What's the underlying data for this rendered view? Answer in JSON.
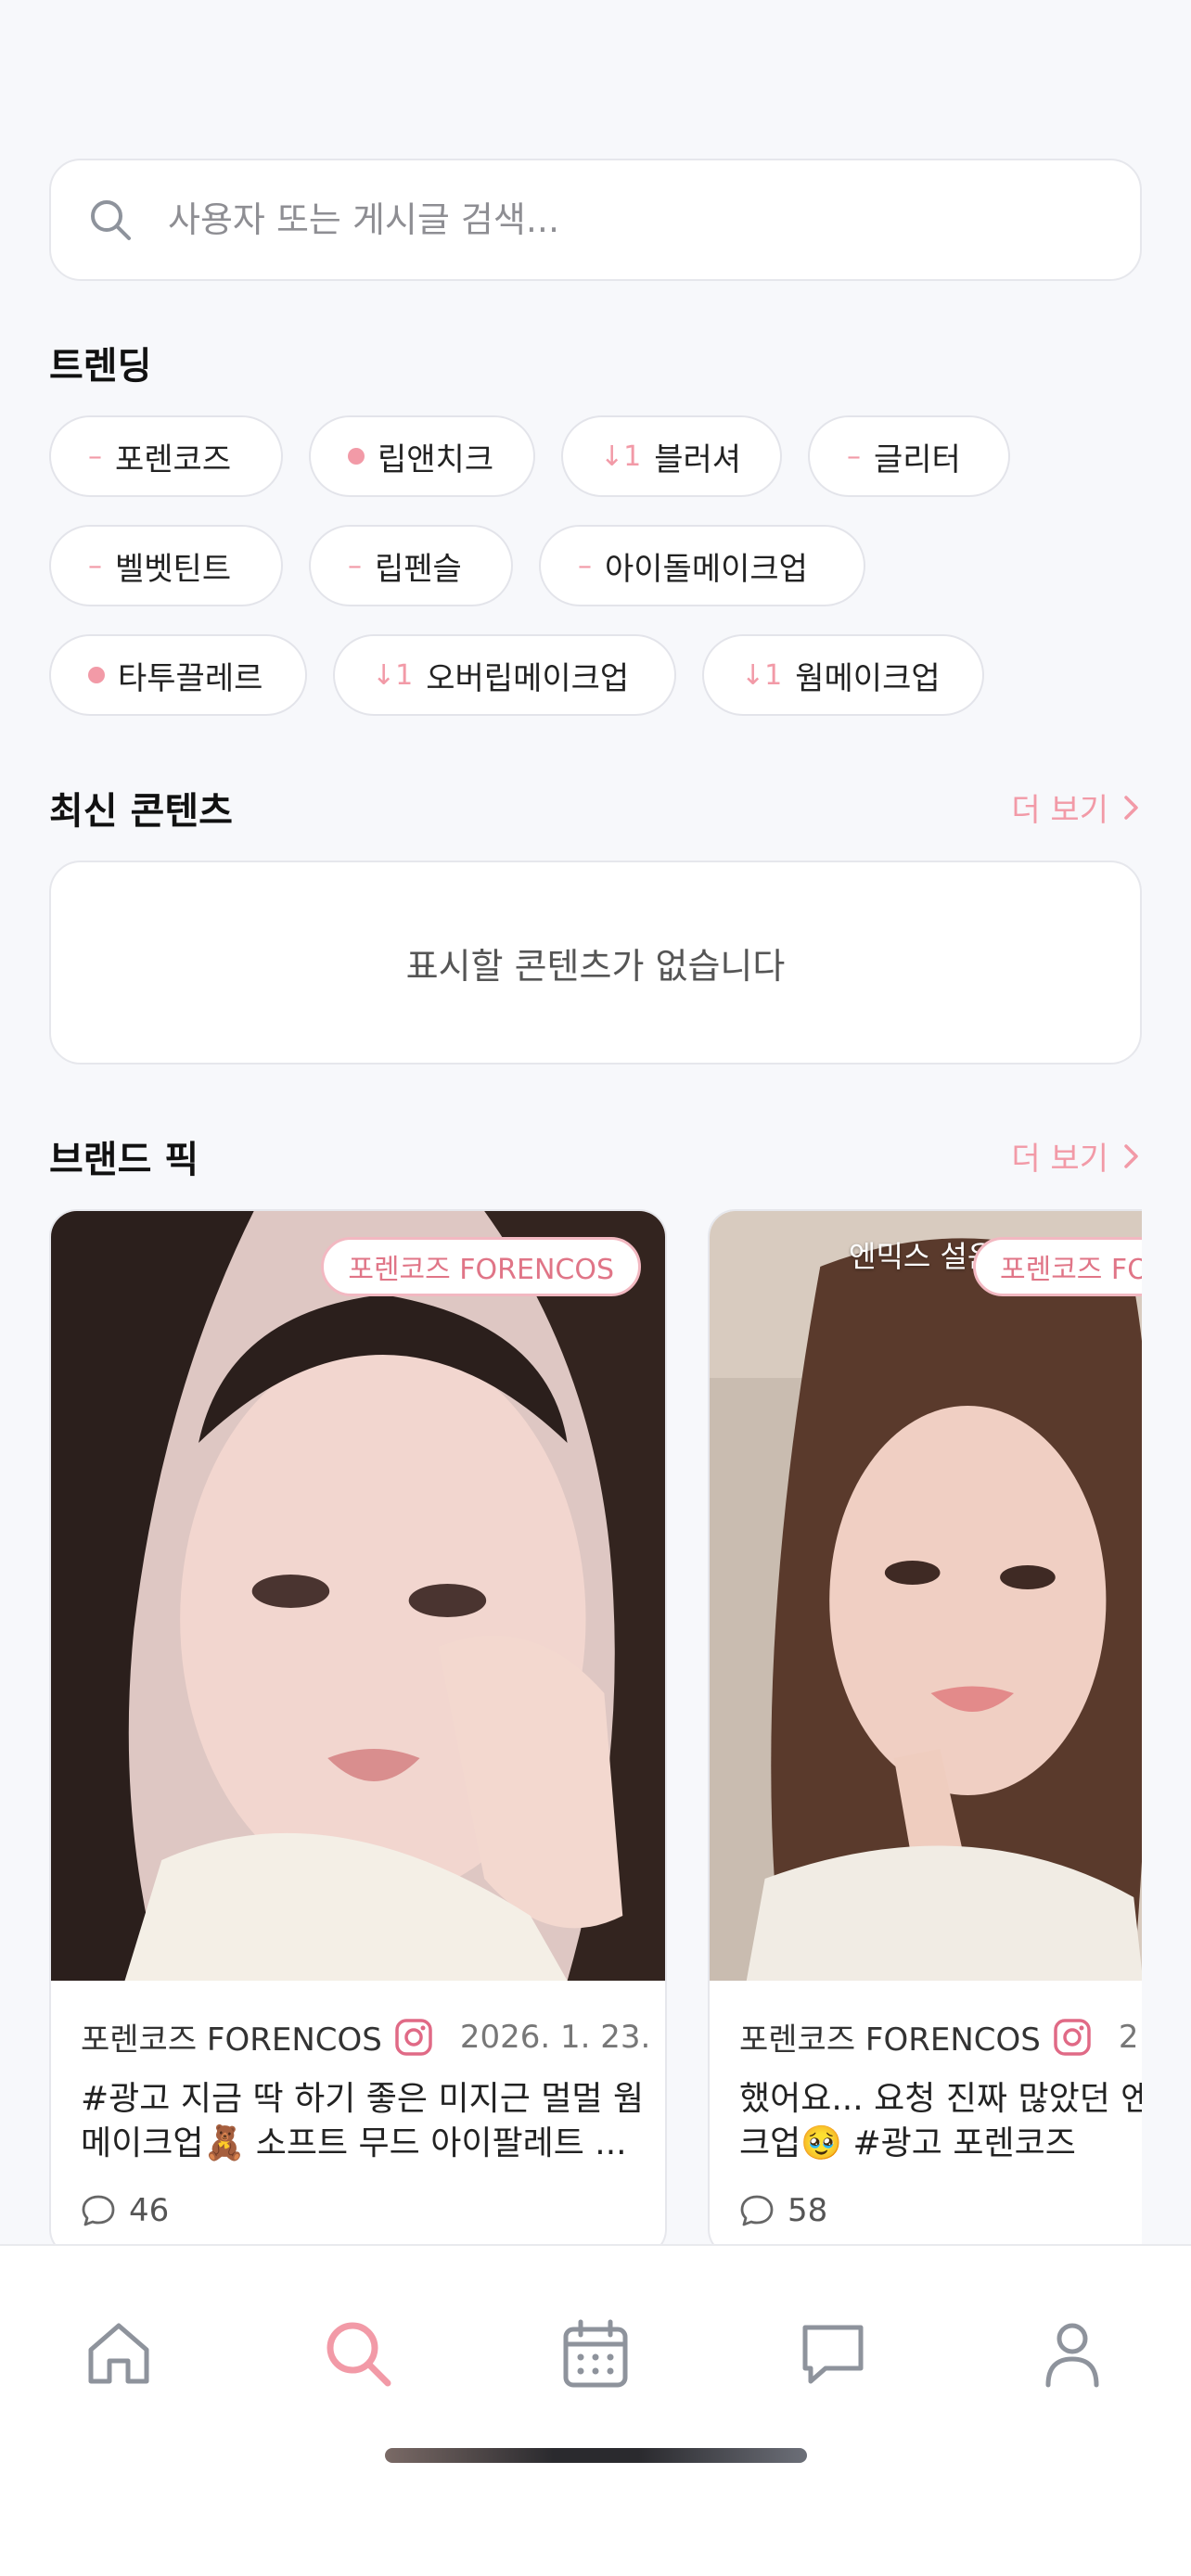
{
  "search": {
    "placeholder": "사용자 또는 게시글 검색..."
  },
  "trending": {
    "title": "트렌딩",
    "rows": [
      [
        {
          "trend": "–",
          "trend_type": "flat",
          "label": "포렌코즈"
        },
        {
          "trend": "",
          "trend_type": "new",
          "label": "립앤치크"
        },
        {
          "trend": "↓1",
          "trend_type": "down",
          "label": "블러셔"
        },
        {
          "trend": "–",
          "trend_type": "flat",
          "label": "글리터"
        }
      ],
      [
        {
          "trend": "–",
          "trend_type": "flat",
          "label": "벨벳틴트"
        },
        {
          "trend": "–",
          "trend_type": "flat",
          "label": "립펜슬"
        },
        {
          "trend": "–",
          "trend_type": "flat",
          "label": "아이돌메이크업"
        }
      ],
      [
        {
          "trend": "",
          "trend_type": "new",
          "label": "타투끌레르"
        },
        {
          "trend": "↓1",
          "trend_type": "down",
          "label": "오버립메이크업"
        },
        {
          "trend": "↓1",
          "trend_type": "down",
          "label": "웜메이크업"
        }
      ]
    ]
  },
  "latest": {
    "title": "최신 콘텐츠",
    "more_label": "더 보기",
    "empty_text": "표시할 콘텐츠가 없습니다"
  },
  "brand_pick": {
    "title": "브랜드 픽",
    "more_label": "더 보기",
    "cards": [
      {
        "badge": "포렌코즈 FORENCOS",
        "overlay": "",
        "author": "포렌코즈 FORENCOS",
        "date": "2026. 1. 23.",
        "caption": "#광고 지금 딱 하기 좋은 미지근 멀멀 웜 메이크업🧸 소프트 무드 아이팔레트 ...",
        "comments": "46"
      },
      {
        "badge": "포렌코즈 FORENCOS",
        "overlay": "엔믹스 설윤",
        "author": "포렌코즈 FORENCOS",
        "date": "2",
        "caption": "했어요... 요청 진짜 많았던 엔믹스 메이크업🥹 #광고 포렌코즈",
        "comments": "58"
      }
    ]
  },
  "tabbar": {
    "items": [
      "home-icon",
      "search-icon",
      "calendar-icon",
      "chat-icon",
      "profile-icon"
    ],
    "active": "search-icon"
  },
  "colors": {
    "accent": "#f29aa7",
    "background": "#f7f8fb",
    "icon": "#8e939c"
  }
}
